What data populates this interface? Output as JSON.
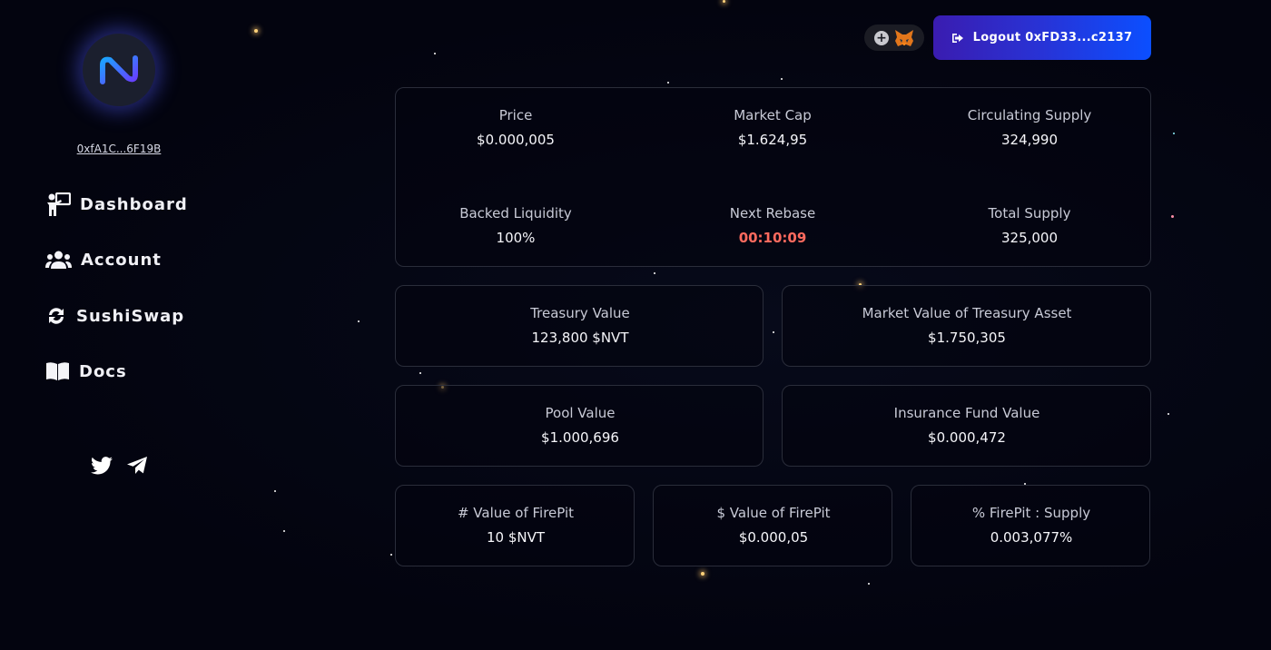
{
  "sidebar": {
    "wallet_address": "0xfA1C...6F19B",
    "nav": [
      {
        "label": "Dashboard",
        "icon": "presenter-icon"
      },
      {
        "label": "Account",
        "icon": "users-icon"
      },
      {
        "label": "SushiSwap",
        "icon": "sync-icon"
      },
      {
        "label": "Docs",
        "icon": "book-icon"
      }
    ],
    "social": [
      "twitter-icon",
      "telegram-icon"
    ]
  },
  "header": {
    "add_token_icon": "plus-icon",
    "wallet_icon": "metamask-fox-icon",
    "logout_label": "Logout 0xFD33...c2137"
  },
  "overview": {
    "price": {
      "label": "Price",
      "value": "$0.000,005"
    },
    "market_cap": {
      "label": "Market Cap",
      "value": "$1.624,95"
    },
    "circulating_supply": {
      "label": "Circulating Supply",
      "value": "324,990"
    },
    "backed_liquidity": {
      "label": "Backed Liquidity",
      "value": "100%"
    },
    "next_rebase": {
      "label": "Next Rebase",
      "value": "00:10:09"
    },
    "total_supply": {
      "label": "Total Supply",
      "value": "325,000"
    }
  },
  "treasury": {
    "treasury_value": {
      "label": "Treasury Value",
      "value": "123,800 $NVT"
    },
    "market_value": {
      "label": "Market Value of Treasury Asset",
      "value": "$1.750,305"
    }
  },
  "funds": {
    "pool_value": {
      "label": "Pool Value",
      "value": "$1.000,696"
    },
    "insurance_fund": {
      "label": "Insurance Fund Value",
      "value": "$0.000,472"
    }
  },
  "firepit": {
    "count_value": {
      "label": "# Value of FirePit",
      "value": "10 $NVT"
    },
    "dollar_value": {
      "label": "$ Value of FirePit",
      "value": "$0.000,05"
    },
    "supply_ratio": {
      "label": "% FirePit : Supply",
      "value": "0.003,077%"
    }
  },
  "colors": {
    "background": "#03040f",
    "card_border": "#2a2d3a",
    "accent_gradient_start": "#3a1cb0",
    "accent_gradient_end": "#0b4fff",
    "alert": "#ff6a5e"
  }
}
